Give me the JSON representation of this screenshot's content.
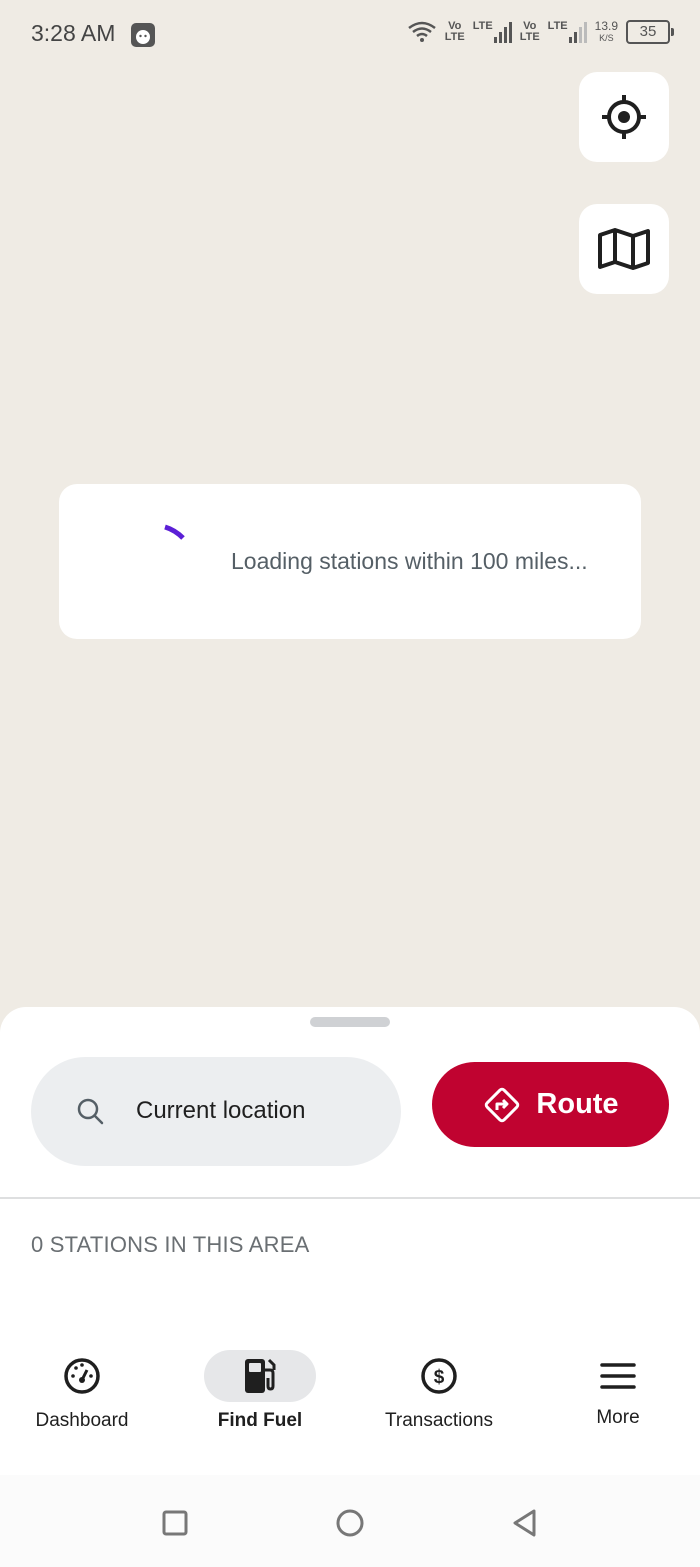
{
  "status_bar": {
    "time": "3:28 AM",
    "network_label_1": "Vo\nLTE",
    "lte_1": "LTE",
    "network_label_2": "Vo\nLTE",
    "lte_2": "LTE",
    "speed_value": "13.9",
    "speed_unit": "K/S",
    "battery": "35"
  },
  "map_controls": {
    "locate_icon": "crosshair-icon",
    "map_icon": "map-icon"
  },
  "loading": {
    "text": "Loading stations within 100 miles..."
  },
  "sheet": {
    "search_value": "Current location",
    "route_label": "Route",
    "stations_count": "0 STATIONS IN THIS AREA"
  },
  "nav": {
    "items": [
      {
        "label": "Dashboard",
        "icon": "gauge-icon"
      },
      {
        "label": "Find Fuel",
        "icon": "fuel-pump-icon"
      },
      {
        "label": "Transactions",
        "icon": "dollar-icon"
      },
      {
        "label": "More",
        "icon": "menu-icon"
      }
    ],
    "active_index": 1
  },
  "colors": {
    "accent": "#c00330",
    "spinner": "#5b1fd6",
    "map_background": "#efebe4"
  }
}
